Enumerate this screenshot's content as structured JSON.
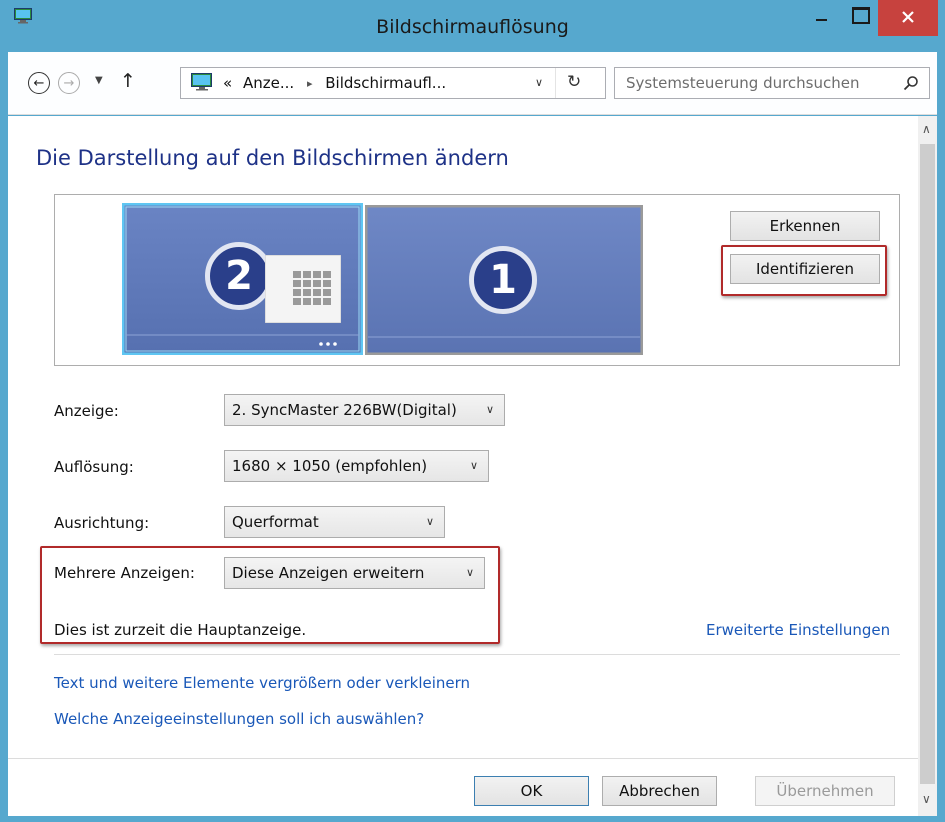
{
  "window": {
    "title": "Bildschirmauflösung"
  },
  "address_bar": {
    "crumb_prefix": "«",
    "crumb_1": "Anze...",
    "crumb_separator": "▸",
    "crumb_2": "Bildschirmaufl...",
    "search_placeholder": "Systemsteuerung durchsuchen"
  },
  "main": {
    "heading": "Die Darstellung auf den Bildschirmen ändern",
    "monitors": [
      {
        "number": "2",
        "selected": true
      },
      {
        "number": "1",
        "selected": false
      }
    ],
    "detect_button": "Erkennen",
    "identify_button": "Identifizieren",
    "fields": {
      "display_label": "Anzeige:",
      "display_value": "2. SyncMaster 226BW(Digital)",
      "resolution_label": "Auflösung:",
      "resolution_value": "1680 × 1050 (empfohlen)",
      "orientation_label": "Ausrichtung:",
      "orientation_value": "Querformat",
      "multi_label": "Mehrere Anzeigen:",
      "multi_value": "Diese Anzeigen erweitern"
    },
    "main_display_note": "Dies ist zurzeit die Hauptanzeige.",
    "advanced_link": "Erweiterte Einstellungen",
    "links": {
      "text_size": "Text und weitere Elemente vergrößern oder verkleinern",
      "which_settings": "Welche Anzeigeeinstellungen soll ich auswählen?"
    }
  },
  "footer": {
    "ok": "OK",
    "cancel": "Abbrechen",
    "apply": "Übernehmen"
  },
  "colors": {
    "titlebar": "#56a8ce",
    "close_button": "#c7423e",
    "heading": "#1e3287",
    "link": "#1a58b8",
    "highlight_box": "#b12a2a",
    "monitor_fill": "#5e78b8",
    "monitor_selected_border": "#5fc6f2"
  }
}
